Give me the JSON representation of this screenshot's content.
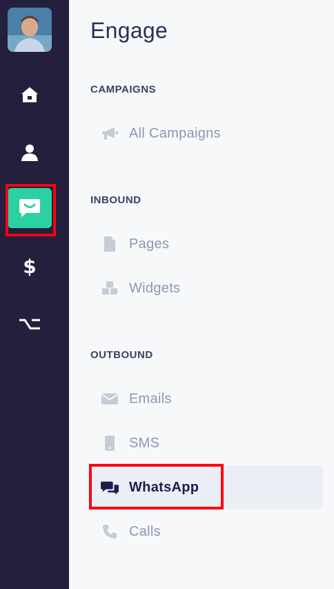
{
  "rail": {
    "items": [
      {
        "name": "home",
        "icon": "home-icon"
      },
      {
        "name": "contacts",
        "icon": "person-icon"
      },
      {
        "name": "engage",
        "icon": "chat-smile-icon",
        "active": true
      },
      {
        "name": "revenue",
        "icon": "dollar-icon",
        "glyph": "$"
      },
      {
        "name": "automations",
        "icon": "flow-icon"
      }
    ]
  },
  "panel": {
    "title": "Engage",
    "sections": [
      {
        "label": "CAMPAIGNS",
        "items": [
          {
            "label": "All Campaigns",
            "icon": "megaphone-icon"
          }
        ]
      },
      {
        "label": "INBOUND",
        "items": [
          {
            "label": "Pages",
            "icon": "file-icon"
          },
          {
            "label": "Widgets",
            "icon": "cubes-icon"
          }
        ]
      },
      {
        "label": "OUTBOUND",
        "items": [
          {
            "label": "Emails",
            "icon": "envelope-icon"
          },
          {
            "label": "SMS",
            "icon": "mobile-icon"
          },
          {
            "label": "WhatsApp",
            "icon": "comments-icon",
            "active": true
          },
          {
            "label": "Calls",
            "icon": "phone-icon"
          }
        ]
      }
    ]
  },
  "colors": {
    "rail": "#231f3d",
    "accent": "#2bd1a2",
    "highlight": "#ff0010",
    "active_text": "#1c1f4a",
    "muted_text": "#8d97b0"
  }
}
